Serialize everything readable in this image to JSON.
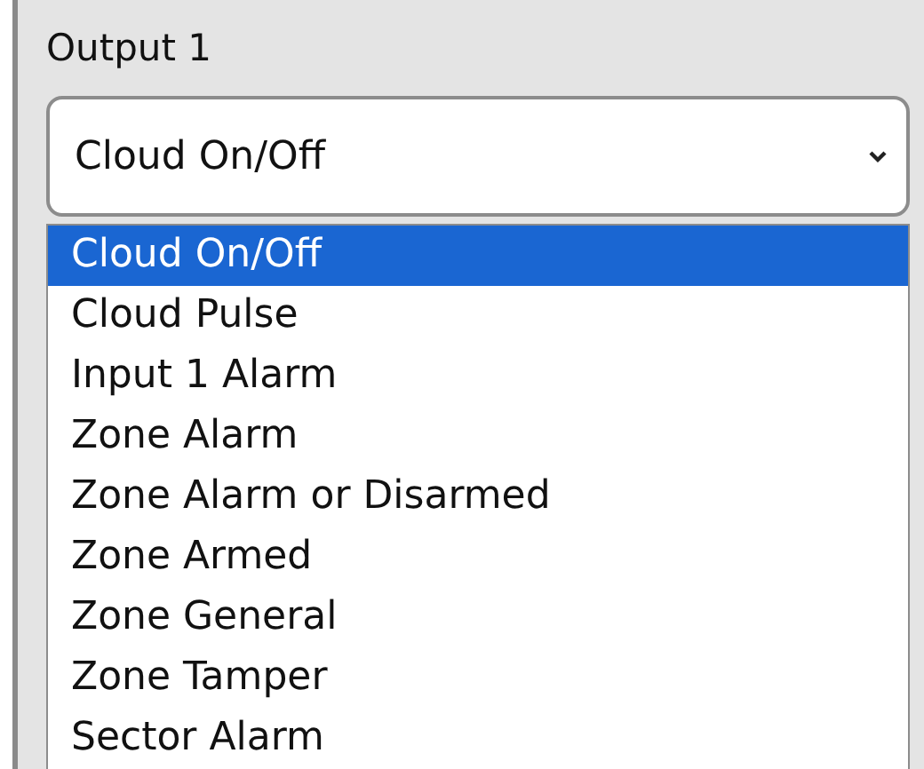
{
  "field": {
    "label": "Output 1",
    "value": "Cloud On/Off"
  },
  "options": [
    {
      "label": "Cloud On/Off",
      "selected": true
    },
    {
      "label": "Cloud Pulse",
      "selected": false
    },
    {
      "label": "Input 1 Alarm",
      "selected": false
    },
    {
      "label": "Zone Alarm",
      "selected": false
    },
    {
      "label": "Zone Alarm or Disarmed",
      "selected": false
    },
    {
      "label": "Zone Armed",
      "selected": false
    },
    {
      "label": "Zone General",
      "selected": false
    },
    {
      "label": "Zone Tamper",
      "selected": false
    },
    {
      "label": "Sector Alarm",
      "selected": false
    }
  ]
}
